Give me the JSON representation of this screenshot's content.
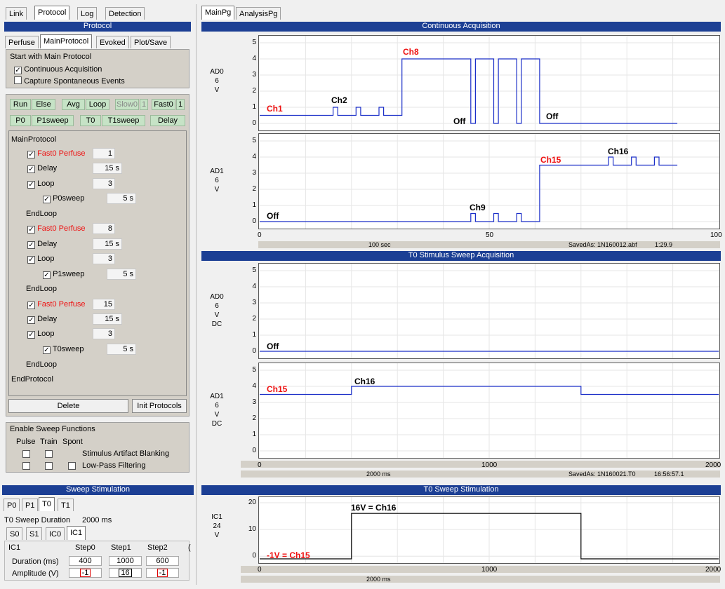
{
  "top_tabs": [
    "Link",
    "Protocol",
    "Log",
    "Detection"
  ],
  "protocol_header": "Protocol",
  "proto_tabs": [
    "Perfuse",
    "MainProtocol",
    "Evoked",
    "Plot/Save"
  ],
  "start_panel": {
    "title": "Start with Main Protocol",
    "opt1": "Continuous Acquisition",
    "opt2": "Capture Spontaneous Events"
  },
  "btn_row1": [
    "Run",
    "Else",
    "Avg",
    "Loop",
    "Slow0",
    "1",
    "Fast0",
    "1"
  ],
  "btn_row2": [
    "P0",
    "P1sweep",
    "T0",
    "T1sweep",
    "Delay"
  ],
  "tree": {
    "main": "MainProtocol",
    "items": [
      {
        "label": "Fast0 Perfuse",
        "value": "1"
      },
      {
        "label": "Delay",
        "value": "15 s"
      },
      {
        "label": "Loop",
        "value": "3"
      },
      {
        "label": "P0sweep",
        "value": "5 s"
      },
      {
        "label": "EndLoop"
      },
      {
        "label": "Fast0 Perfuse",
        "value": "8"
      },
      {
        "label": "Delay",
        "value": "15 s"
      },
      {
        "label": "Loop",
        "value": "3"
      },
      {
        "label": "P1sweep",
        "value": "5 s"
      },
      {
        "label": "EndLoop"
      },
      {
        "label": "Fast0 Perfuse",
        "value": "15"
      },
      {
        "label": "Delay",
        "value": "15 s"
      },
      {
        "label": "Loop",
        "value": "3"
      },
      {
        "label": "T0sweep",
        "value": "5 s"
      },
      {
        "label": "EndLoop"
      }
    ],
    "end": "EndProtocol"
  },
  "delete_label": "Delete",
  "init_label": "Init Protocols",
  "sweep_panel": {
    "title": "Enable Sweep Functions",
    "cols": [
      "Pulse",
      "Train",
      "Spont"
    ],
    "opt1": "Stimulus Artifact Blanking",
    "opt2": "Low-Pass Filtering"
  },
  "stim_header": "Sweep Stimulation",
  "stim_tabs": [
    "P0",
    "P1",
    "T0",
    "T1"
  ],
  "sweep_duration_label": "T0 Sweep Duration",
  "sweep_duration_value": "2000 ms",
  "sub_tabs": [
    "S0",
    "S1",
    "IC0",
    "IC1"
  ],
  "table": {
    "corner": "IC1",
    "headers": [
      "Step0",
      "Step1",
      "Step2"
    ],
    "rows": [
      {
        "label": "Duration (ms)",
        "values": [
          "400",
          "1000",
          "600"
        ]
      },
      {
        "label": "Amplitude (V)",
        "values": [
          "-1",
          "16",
          "-1"
        ]
      }
    ]
  },
  "right_tabs": [
    "MainPg",
    "AnalysisPg"
  ],
  "headers": {
    "continuous": "Continuous Acquisition",
    "t0_acq": "T0 Stimulus Sweep Acquisition",
    "t0_stim": "T0 Sweep Stimulation"
  },
  "ch_labels": {
    "ad0": [
      "AD0",
      "6",
      "V"
    ],
    "ad1": [
      "AD1",
      "6",
      "V"
    ],
    "ad0dc": [
      "AD0",
      "6",
      "V",
      "DC"
    ],
    "ad1dc": [
      "AD1",
      "6",
      "V",
      "DC"
    ],
    "ic1": [
      "IC1",
      "24",
      "V"
    ]
  },
  "status1": {
    "left": "100 sec",
    "saved": "SavedAs: 1N160012.abf",
    "time": "1:29.9"
  },
  "status2": {
    "left": "2000 ms",
    "saved": "SavedAs: 1N160021.T0",
    "time": "16:56:57.1"
  },
  "status3": {
    "left": "2000 ms"
  },
  "colors": {
    "header": "#1c3f94",
    "trace": "#1a2ec8",
    "green_btn": "#c6e3c6",
    "red_text": "#e11"
  },
  "chart_data": [
    {
      "type": "line",
      "name": "AD0 continuous",
      "ylim": [
        0,
        5
      ],
      "xlim": [
        0,
        100
      ],
      "yticks": [
        0,
        1,
        2,
        3,
        4,
        5
      ],
      "xticks": [
        "0",
        "50",
        "100"
      ],
      "x": [
        0,
        16,
        16,
        17,
        17,
        21,
        21,
        22,
        22,
        26,
        26,
        27,
        27,
        31,
        31,
        46,
        46,
        47,
        47,
        51,
        51,
        52,
        52,
        56,
        56,
        57,
        57,
        61,
        61,
        91
      ],
      "y": [
        0.5,
        0.5,
        1,
        1,
        0.5,
        0.5,
        1,
        1,
        0.5,
        0.5,
        1,
        1,
        0.5,
        0.5,
        4,
        4,
        0,
        0,
        4,
        4,
        0,
        0,
        4,
        4,
        0,
        0,
        4,
        4,
        0,
        0
      ],
      "annotations": [
        {
          "text": "Ch1",
          "red": true
        },
        {
          "text": "Ch2"
        },
        {
          "text": "Ch8",
          "red": true
        },
        {
          "text": "Off"
        },
        {
          "text": "Off"
        }
      ]
    },
    {
      "type": "line",
      "name": "AD1 continuous",
      "ylim": [
        0,
        5
      ],
      "xlim": [
        0,
        100
      ],
      "yticks": [
        0,
        1,
        2,
        3,
        4,
        5
      ],
      "xticks": [
        "0",
        "50",
        "100"
      ],
      "x": [
        0,
        46,
        46,
        47,
        47,
        51,
        51,
        52,
        52,
        56,
        56,
        57,
        57,
        61,
        61,
        76,
        76,
        77,
        77,
        81,
        81,
        82,
        82,
        86,
        86,
        87,
        87,
        91
      ],
      "y": [
        0,
        0,
        0.5,
        0.5,
        0,
        0,
        0.5,
        0.5,
        0,
        0,
        0.5,
        0.5,
        0,
        0,
        3.5,
        3.5,
        4,
        4,
        3.5,
        3.5,
        4,
        4,
        3.5,
        3.5,
        4,
        4,
        3.5,
        3.5
      ],
      "annotations": [
        {
          "text": "Off"
        },
        {
          "text": "Ch9"
        },
        {
          "text": "Ch15",
          "red": true
        },
        {
          "text": "Ch16"
        }
      ]
    },
    {
      "type": "line",
      "name": "AD0 T0 sweep",
      "ylim": [
        0,
        5
      ],
      "xlim": [
        0,
        2000
      ],
      "yticks": [
        0,
        1,
        2,
        3,
        4,
        5
      ],
      "xticks": [
        "0",
        "1000",
        "2000"
      ],
      "x": [
        0,
        2000
      ],
      "y": [
        0,
        0
      ],
      "annotations": [
        {
          "text": "Off"
        }
      ]
    },
    {
      "type": "line",
      "name": "AD1 T0 sweep",
      "ylim": [
        0,
        5
      ],
      "xlim": [
        0,
        2000
      ],
      "yticks": [
        0,
        1,
        2,
        3,
        4,
        5
      ],
      "xticks": [
        "0",
        "1000",
        "2000"
      ],
      "x": [
        0,
        400,
        400,
        1400,
        1400,
        2000
      ],
      "y": [
        3.5,
        3.5,
        4,
        4,
        3.5,
        3.5
      ],
      "annotations": [
        {
          "text": "Ch15",
          "red": true
        },
        {
          "text": "Ch16"
        }
      ]
    },
    {
      "type": "line",
      "name": "IC1 stimulation",
      "ylim": [
        -1,
        20
      ],
      "xlim": [
        0,
        2000
      ],
      "yticks": [
        0,
        10,
        20
      ],
      "xticks": [
        "0",
        "1000",
        "2000"
      ],
      "x": [
        0,
        400,
        400,
        1400,
        1400,
        2000
      ],
      "y": [
        -1,
        -1,
        16,
        16,
        -1,
        -1
      ],
      "annotations": [
        {
          "text": "16V = Ch16"
        },
        {
          "text": "-1V = Ch15",
          "red": true
        }
      ]
    }
  ]
}
